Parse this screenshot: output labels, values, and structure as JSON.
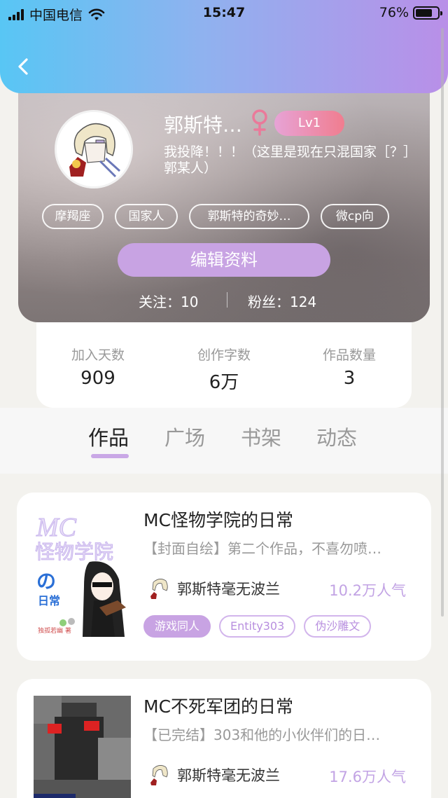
{
  "status_bar": {
    "carrier": "中国电信",
    "time": "15:47",
    "battery": "76%",
    "battery_level": 0.76
  },
  "profile": {
    "name": "郭斯特…",
    "level": "Lv1",
    "bio_line1": "我投降！！！（这里是现在只混国家［？］",
    "bio_line2": "郭某人）",
    "tags": [
      "摩羯座",
      "国家人",
      "郭斯特的奇妙…",
      "微cp向"
    ],
    "edit_button": "编辑资料",
    "following": "关注：10",
    "followers": "粉丝：124"
  },
  "stats": [
    {
      "label": "加入天数",
      "value": "909"
    },
    {
      "label": "创作字数",
      "value": "6万"
    },
    {
      "label": "作品数量",
      "value": "3"
    }
  ],
  "tabs": [
    "作品",
    "广场",
    "书架",
    "动态"
  ],
  "works": [
    {
      "title": "MC怪物学院的日常",
      "desc": "【封面自绘】第二个作品，不喜勿喷…",
      "author": "郭斯特毫无波兰",
      "popularity": "10.2万人气",
      "tags": [
        "游戏同人",
        "Entity303",
        "伪沙雕文"
      ],
      "cover_text": {
        "logo": "MC",
        "subtitle": "怪物学院",
        "kana": "の",
        "small": "日常",
        "credit": "独孤若幽 著"
      }
    },
    {
      "title": "MC不死军团的日常",
      "desc": "【已完结】303和他的小伙伴们的日…",
      "author": "郭斯特毫无波兰",
      "popularity": "17.6万人气",
      "tags": []
    }
  ],
  "colors": {
    "accent": "#c8a3e3",
    "header_start": "#58c6f4",
    "header_end": "#b98fe8"
  }
}
